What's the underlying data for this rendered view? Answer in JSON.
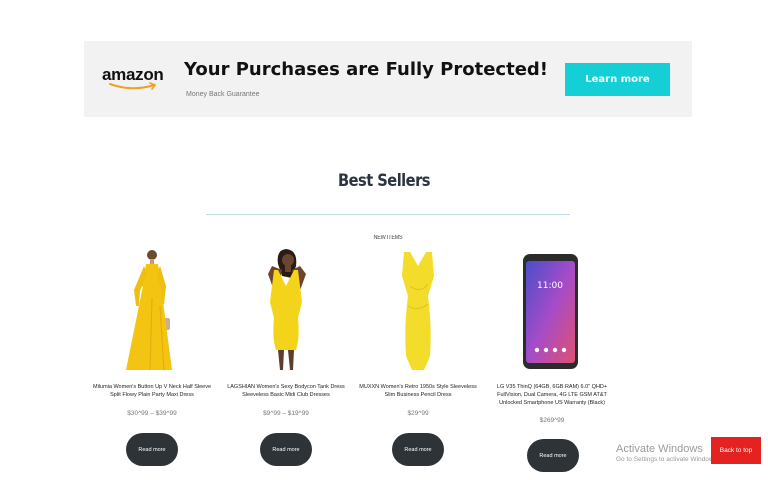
{
  "banner": {
    "logo_text": "amazon",
    "title": "Your Purchases are Fully Protected!",
    "subtitle": "Money Back Guarantee",
    "cta_label": "Learn more"
  },
  "section": {
    "title": "Best Sellers",
    "tag": "NEW ITEMS"
  },
  "products": [
    {
      "name": "Milumia Women's Button Up V Neck Half Sleeve Split Flowy Plain Party Maxi Dress",
      "price": "$30^99 – $39^99",
      "button": "Read more"
    },
    {
      "name": "LAGSHIAN Women's Sexy Bodycon Tank Dress Sleeveless Basic Midi Club Dresses",
      "price": "$9^99 – $19^99",
      "button": "Read more"
    },
    {
      "name": "MUXXN Women's Retro 1950s Style Sleeveless Slim Business Pencil Dress",
      "price": "$29^99",
      "button": "Read more"
    },
    {
      "name": "LG V35 ThinQ (64GB, 6GB RAM) 6.0\" QHD+ FullVision, Dual Camera, 4G LTE GSM AT&T Unlocked Smartphone US Warranty (Black)",
      "price": "$269^99",
      "button": "Read more"
    }
  ],
  "phone_screen": {
    "time": "11:00"
  },
  "watermark": {
    "title": "Activate Windows",
    "subtitle": "Go to Settings to activate Windows."
  },
  "back_to_top": "Back to top",
  "colors": {
    "accent_cyan": "#14d0d6",
    "button_dark": "#2e3338",
    "back_to_top_red": "#e42222",
    "dress_yellow": "#f3c411"
  }
}
